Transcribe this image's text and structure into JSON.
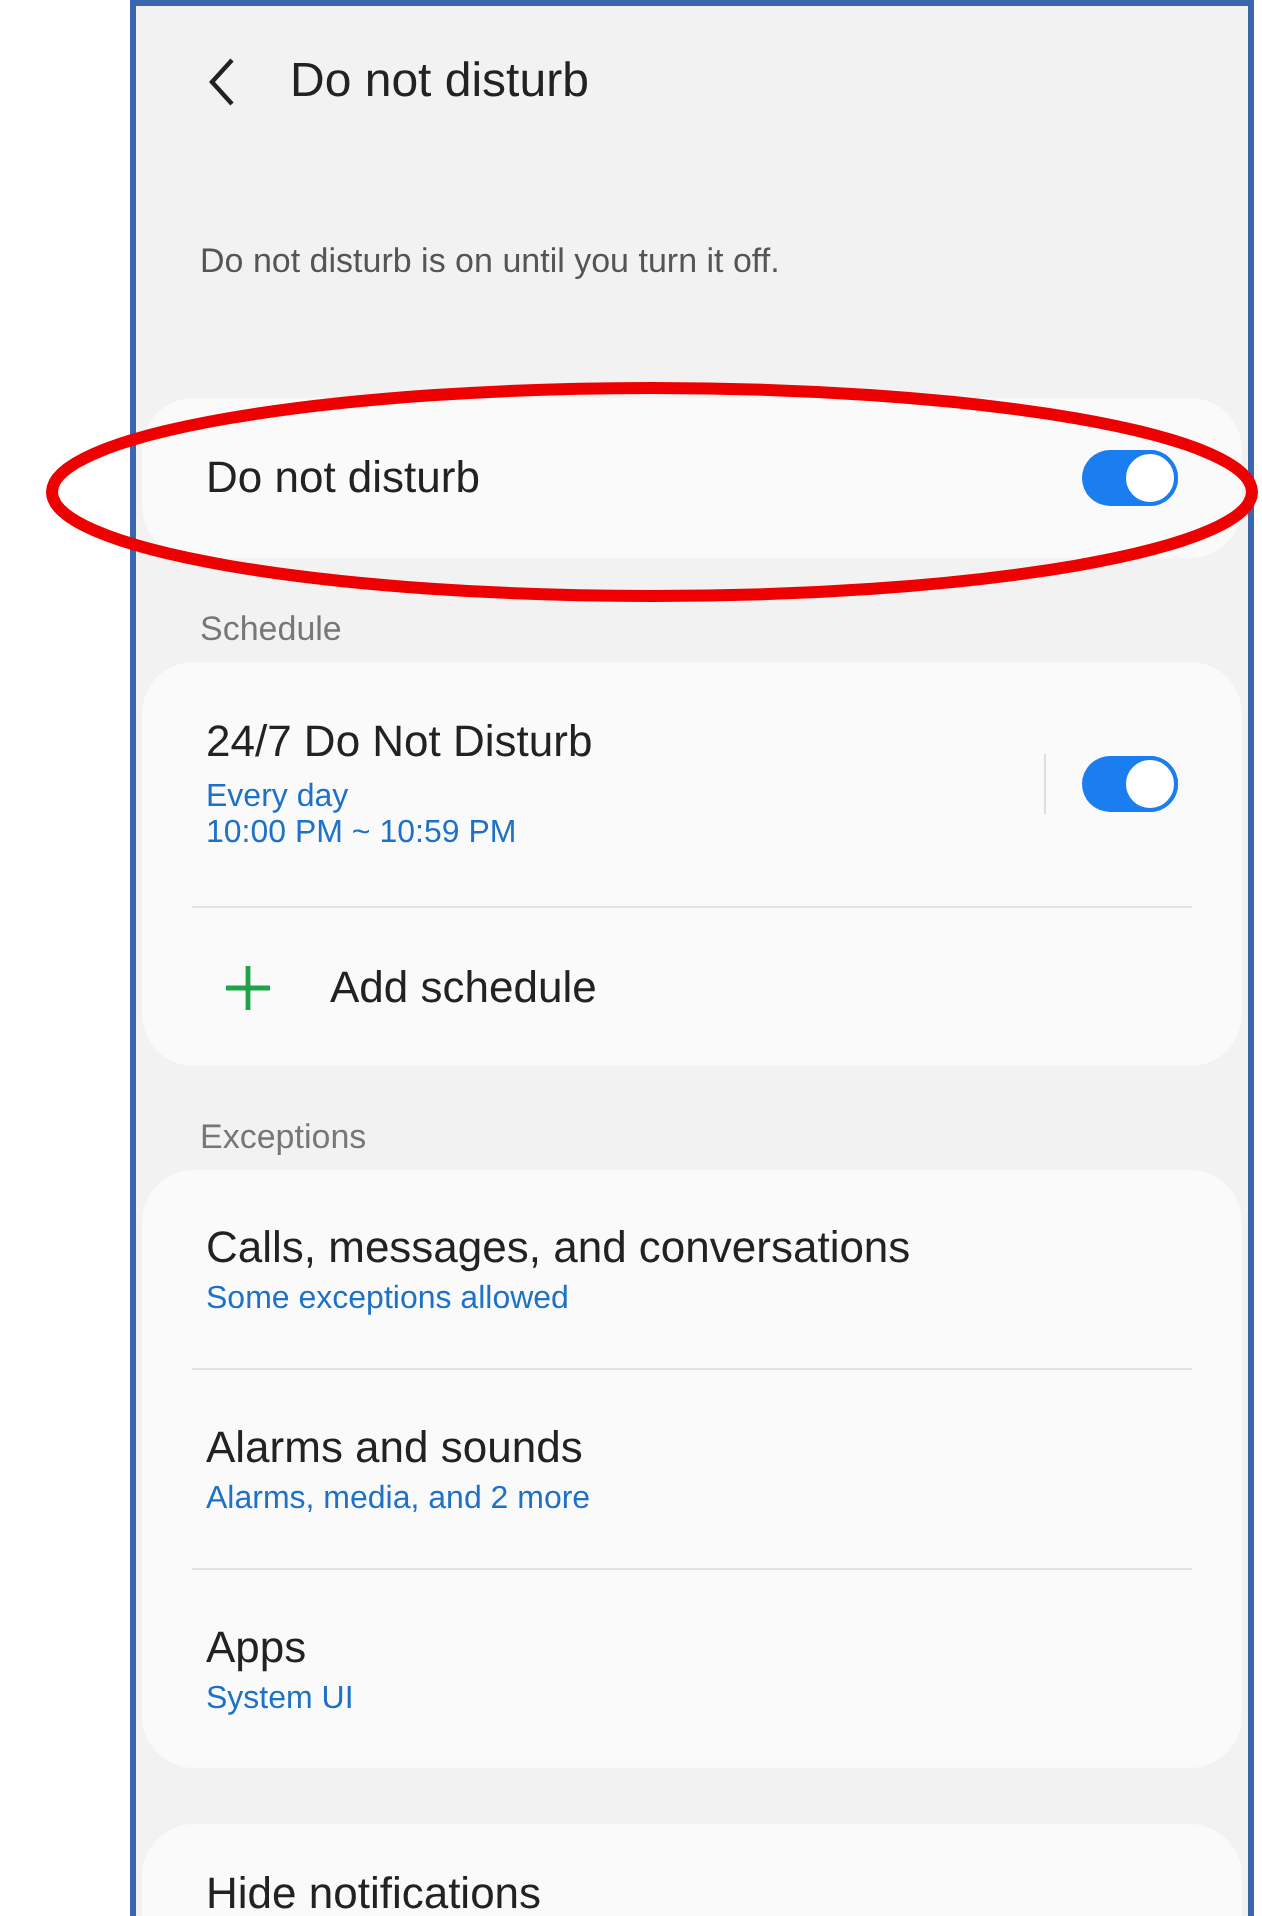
{
  "header": {
    "title": "Do not disturb"
  },
  "description": "Do not disturb is on until you turn it off.",
  "main_toggle": {
    "label": "Do not disturb",
    "on": true
  },
  "sections": [
    {
      "title": "Schedule",
      "items": [
        {
          "kind": "schedule",
          "title": "24/7 Do Not Disturb",
          "lines": [
            "Every day",
            "10:00 PM ~ 10:59 PM"
          ],
          "on": true
        },
        {
          "kind": "add",
          "label": "Add schedule"
        }
      ]
    },
    {
      "title": "Exceptions",
      "items": [
        {
          "kind": "link",
          "title": "Calls, messages, and conversations",
          "subtitle": "Some exceptions allowed"
        },
        {
          "kind": "link",
          "title": "Alarms and sounds",
          "subtitle": "Alarms, media, and 2 more"
        },
        {
          "kind": "link",
          "title": "Apps",
          "subtitle": "System UI"
        }
      ]
    }
  ],
  "last_card": {
    "title": "Hide notifications"
  }
}
